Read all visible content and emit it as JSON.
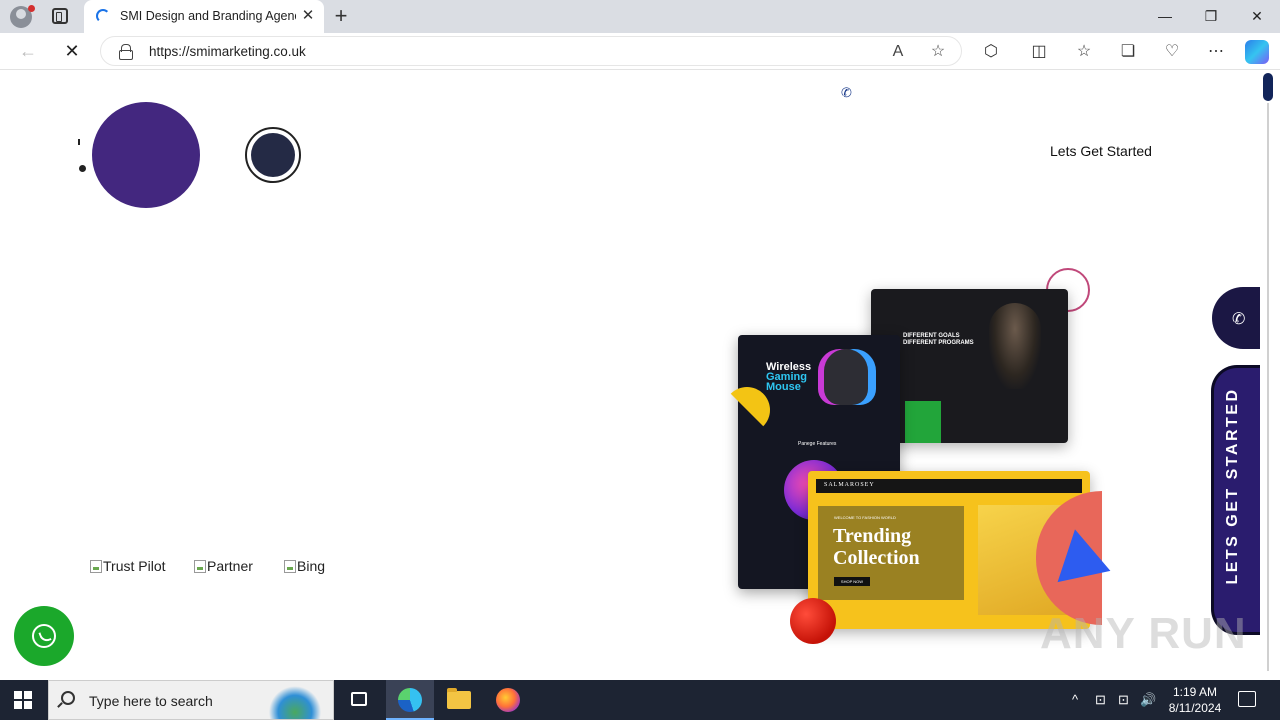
{
  "browser": {
    "tab_title": "SMI Design and Branding Agency",
    "tab_close": "✕",
    "new_tab": "+",
    "window_controls": {
      "minimize": "—",
      "restore": "❐",
      "close": "✕"
    },
    "url": "https://smimarketing.co.uk",
    "nav": {
      "back": "←",
      "stop": "✕"
    },
    "toolbar_icons": {
      "read_aloud": "A",
      "favorite_add": "☆",
      "extensions": "⬡",
      "split_screen": "◫",
      "favorites": "☆",
      "collections": "❏",
      "performance": "♡",
      "menu": "⋯"
    }
  },
  "page": {
    "phone_icon": "✆",
    "lets_get_started": "Lets Get Started",
    "partners": [
      {
        "alt": "Trust Pilot"
      },
      {
        "alt": "Partner"
      },
      {
        "alt": "Bing"
      }
    ],
    "side_cta": "LETS GET STARTED",
    "side_phone_icon": "✆",
    "hero_mockups": {
      "dark1_headline": "DIFFERENT GOALS\nDIFFERENT PROGRAMS",
      "dark2_title_1": "Wireless",
      "dark2_title_2": "Gaming",
      "dark2_title_3": "Mouse",
      "dark2_sub": "Panege Features",
      "yellow_brand": "SALMAROSEY",
      "yellow_small": "WELCOME TO FASHION WORLD",
      "yellow_title_1": "Trending",
      "yellow_title_2": "Collection",
      "yellow_button": "SHOP NOW"
    },
    "watermark": "ANY RUN"
  },
  "taskbar": {
    "search_placeholder": "Type here to search",
    "tray": {
      "chevron": "^",
      "network": "⊡",
      "volume": "🔊"
    },
    "time": "1:19 AM",
    "date": "8/11/2024"
  },
  "colors": {
    "purple_blob": "#43277f",
    "cta_bg": "#2a1c6e",
    "whatsapp": "#1ba82b"
  }
}
